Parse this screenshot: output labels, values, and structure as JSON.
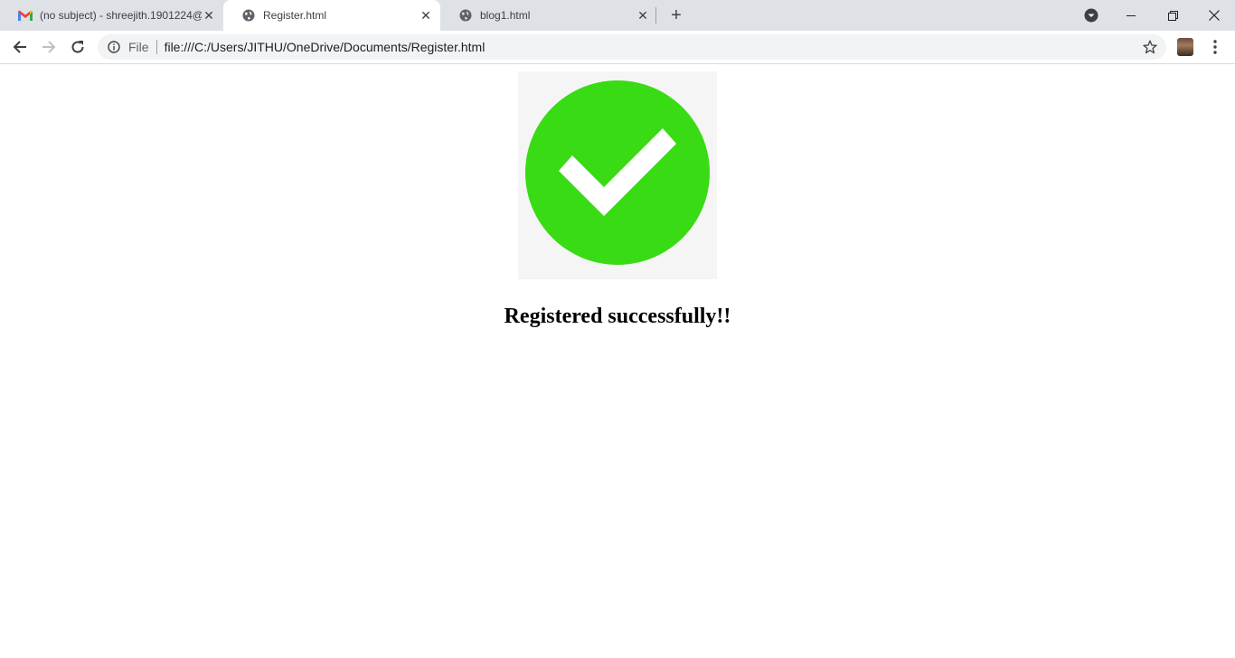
{
  "tabs": [
    {
      "title": "(no subject) - shreejith.1901224@",
      "icon": "gmail-icon",
      "active": false
    },
    {
      "title": "Register.html",
      "icon": "globe-icon",
      "active": true
    },
    {
      "title": "blog1.html",
      "icon": "globe-icon",
      "active": false
    }
  ],
  "address_bar": {
    "scheme_label": "File",
    "url": "file:///C:/Users/JITHU/OneDrive/Documents/Register.html"
  },
  "page": {
    "image_icon": "check-circle-icon",
    "heading": "Registered successfully!!"
  },
  "colors": {
    "success_green": "#39db14",
    "tabstrip_bg": "#dee1e6",
    "omnibox_bg": "#f1f3f4"
  }
}
